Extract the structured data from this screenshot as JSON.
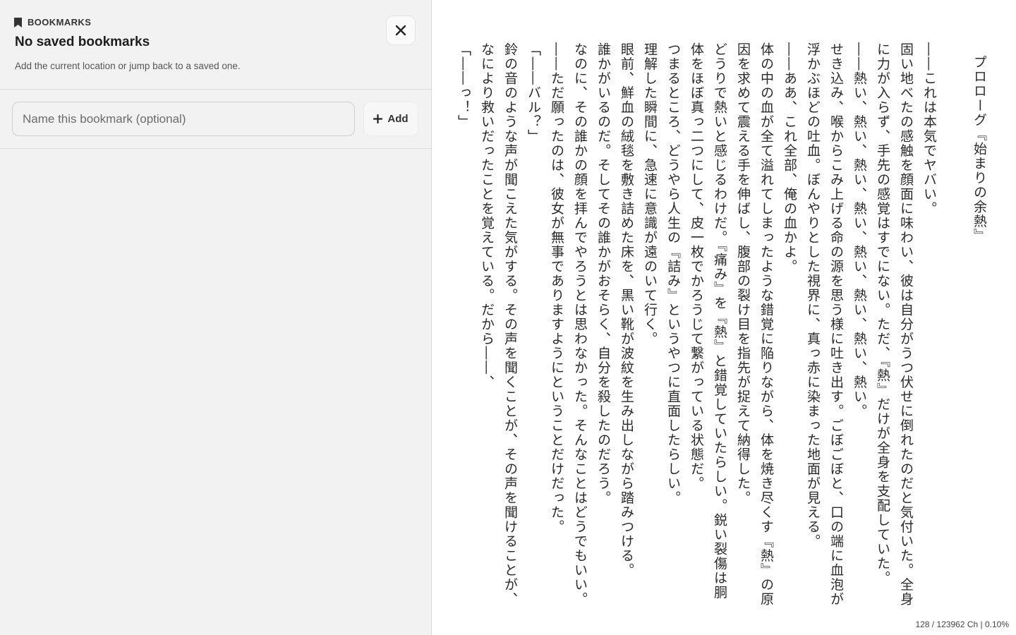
{
  "bookmarks_panel": {
    "section_label": "BOOKMARKS",
    "title": "No saved bookmarks",
    "subtitle": "Add the current location or jump back to a saved one.",
    "close_icon": "close-icon",
    "name_input": {
      "value": "",
      "placeholder": "Name this bookmark (optional)"
    },
    "add_button_label": "Add",
    "add_icon": "plus-icon"
  },
  "reader": {
    "chapter_title": "プロローグ『始まりの余熱』",
    "paragraphs": [
      "――これは本気でヤバい。",
      "固い地べたの感触を顔面に味わい、彼は自分がうつ伏せに倒れたのだと気付いた。全身に力が入らず、手先の感覚はすでにない。ただ、『熱』だけが全身を支配していた。",
      "――熱い、熱い、熱い、熱い、熱い、熱い、熱い、熱い。",
      "せき込み、喉からこみ上げる命の源を思う様に吐き出す。ごぼごぼと、口の端に血泡が浮かぶほどの吐血。ぼんやりとした視界に、真っ赤に染まった地面が見える。",
      "――ああ、これ全部、俺の血かよ。",
      "体の中の血が全て溢れてしまったような錯覚に陥りながら、体を焼き尽くす『熱』の原因を求めて震える手を伸ばし、腹部の裂け目を指先が捉えて納得した。",
      "どうりで熱いと感じるわけだ。『痛み』を『熱』と錯覚していたらしい。鋭い裂傷は胴体をほぼ真っ二つにして、皮一枚でかろうじて繋がっている状態だ。",
      "つまるところ、どうやら人生の『詰み』というやつに直面したらしい。",
      "理解した瞬間に、急速に意識が遠のいて行く。",
      "眼前、鮮血の絨毯を敷き詰めた床を、黒い靴が波紋を生み出しながら踏みつける。",
      "誰かがいるのだ。そしてその誰かがおそらく、自分を殺したのだろう。",
      "なのに、その誰かの顔を拝んでやろうとは思わなかった。そんなことはどうでもいい。",
      "――ただ願ったのは、彼女が無事でありますようにということだけだった。",
      "「――バル？」",
      "鈴の音のような声が聞こえた気がする。その声を聞くことが、その声を聞けることが、なにより救いだったことを覚えている。だから――、",
      "「――っ！」"
    ],
    "status": "128 / 123962 Ch | 0.10%"
  }
}
